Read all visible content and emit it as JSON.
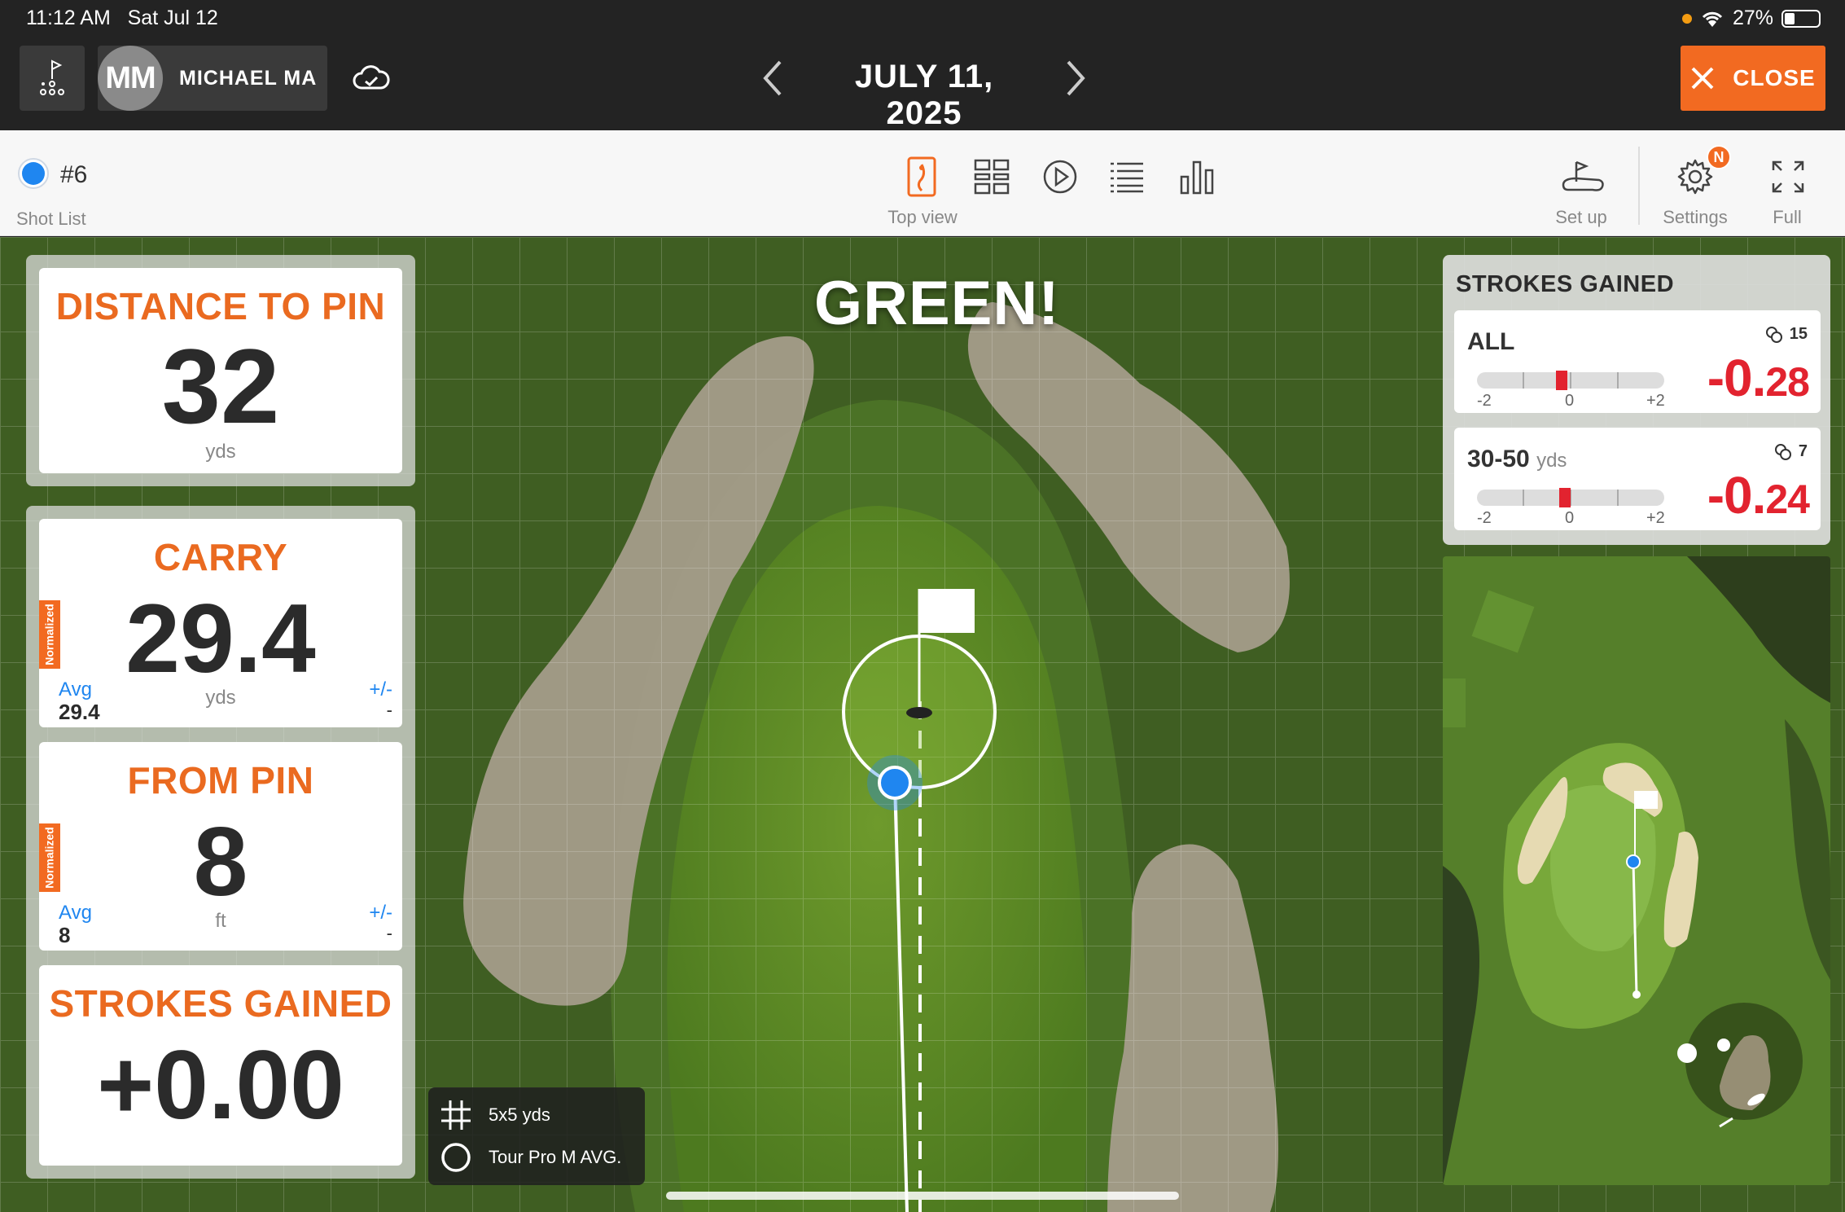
{
  "status_bar": {
    "time": "11:12 AM",
    "date": "Sat Jul 12",
    "battery": "27%"
  },
  "header": {
    "avatar_initials": "MM",
    "user_name": "MICHAEL MA",
    "date": "JULY 11, 2025",
    "close_label": "CLOSE"
  },
  "toolbar": {
    "shot_number": "#6",
    "shot_list_label": "Shot List",
    "top_view_label": "Top view",
    "setup_label": "Set up",
    "settings_label": "Settings",
    "settings_badge": "N",
    "full_label": "Full"
  },
  "banner": "GREEN!",
  "cards": {
    "distance_to_pin": {
      "title": "DISTANCE TO PIN",
      "value": "32",
      "unit": "yds"
    },
    "carry": {
      "title": "CARRY",
      "value": "29.4",
      "unit": "yds",
      "tag": "Normalized",
      "avg_label": "Avg",
      "avg_value": "29.4",
      "pm_label": "+/-",
      "pm_value": "-"
    },
    "from_pin": {
      "title": "FROM PIN",
      "value": "8",
      "unit": "ft",
      "tag": "Normalized",
      "avg_label": "Avg",
      "avg_value": "8",
      "pm_label": "+/-",
      "pm_value": "-"
    },
    "strokes_gained": {
      "title": "STROKES GAINED",
      "value": "+0.00"
    }
  },
  "legend": {
    "grid_label": "5x5 yds",
    "circle_label": "Tour Pro M AVG."
  },
  "sg_panel": {
    "title": "STROKES GAINED",
    "rows": [
      {
        "label": "ALL",
        "sublabel": "",
        "count": "15",
        "value_main": "-0.",
        "value_small": "28",
        "marker_fraction": 0.45,
        "axis": [
          "-2",
          "0",
          "+2"
        ]
      },
      {
        "label": "30-50",
        "sublabel": "yds",
        "count": "7",
        "value_main": "-0.",
        "value_small": "24",
        "marker_fraction": 0.47,
        "axis": [
          "-2",
          "0",
          "+2"
        ]
      }
    ]
  },
  "colors": {
    "accent": "#f26a21",
    "negative": "#e2232f",
    "shot_blue": "#1f86f0",
    "topbar": "#232323"
  },
  "icons": [
    "flag-tee-icon",
    "cloud-sync-icon",
    "chevron-left-icon",
    "chevron-right-icon",
    "close-icon",
    "top-view-icon",
    "grid-view-icon",
    "play-icon",
    "list-icon",
    "bar-chart-icon",
    "setup-icon",
    "gear-icon",
    "expand-icon",
    "grid-hash-icon",
    "circle-outline-icon",
    "ball-icon"
  ]
}
